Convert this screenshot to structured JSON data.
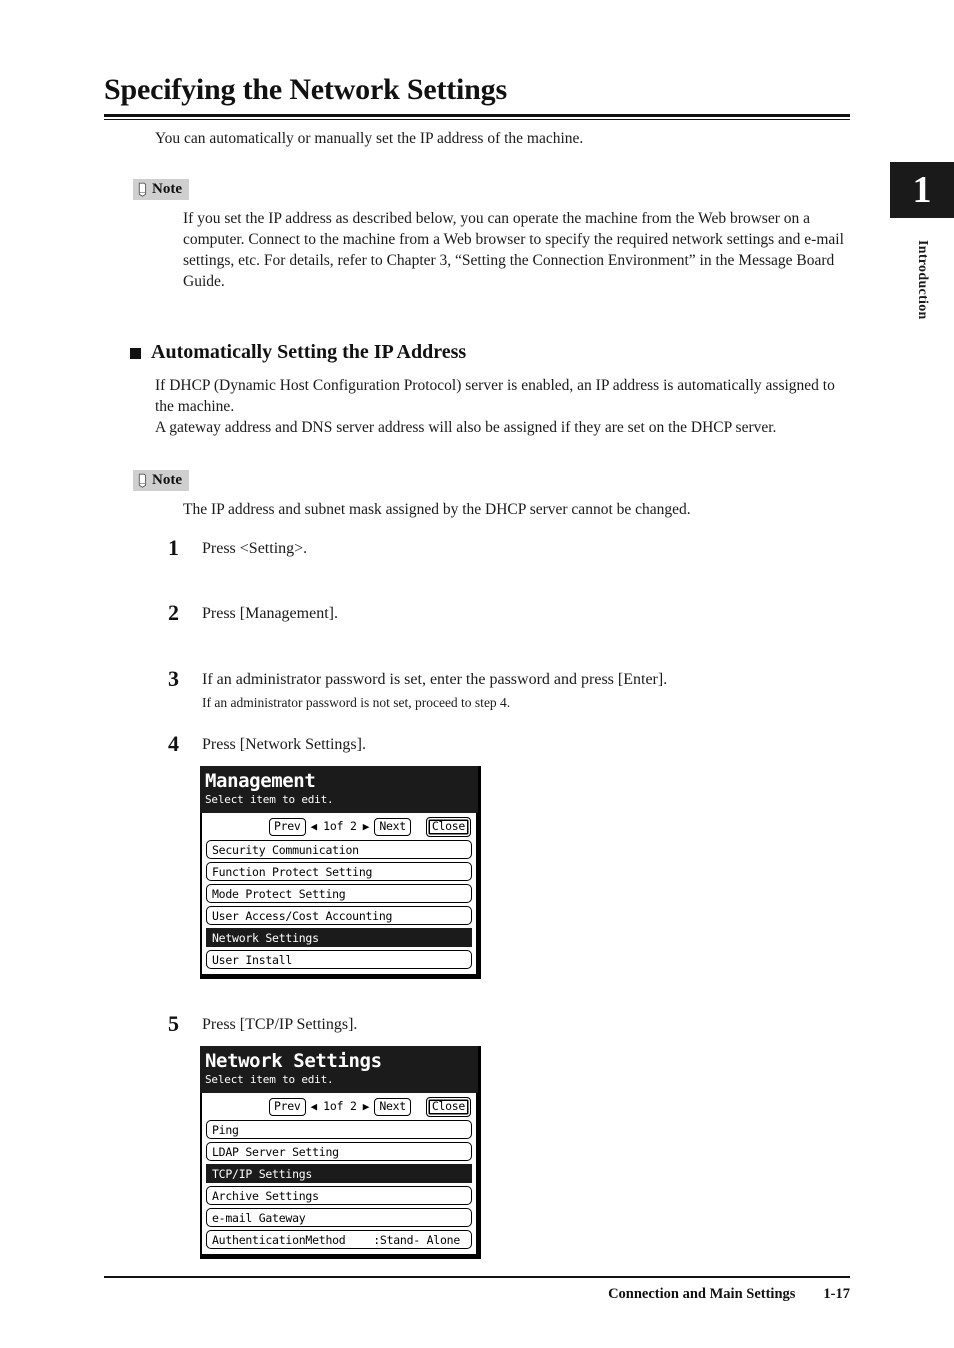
{
  "document": {
    "title": "Specifying the Network Settings",
    "intro": "You can automatically or manually set the IP address of the machine."
  },
  "chapter_tab": {
    "number": "1",
    "label": "Introduction"
  },
  "note_1": {
    "badge": "Note",
    "icon": "note-pencil-icon",
    "text": "If you set the IP address as described below, you can operate the machine from the Web browser on a computer. Connect to the machine from a Web browser to specify the required network settings and e-mail settings, etc. For details, refer to Chapter 3, “Setting the Connection Environment” in the Message Board Guide."
  },
  "section": {
    "marker": "square-bullet-icon",
    "heading": "Automatically Setting the IP Address",
    "paragraph_1": "If DHCP (Dynamic Host Configuration Protocol) server is enabled, an IP address is automatically assigned to the machine.",
    "paragraph_2": "A gateway address and DNS server address will also be assigned if they are set on the DHCP server."
  },
  "note_2": {
    "badge": "Note",
    "icon": "note-pencil-icon",
    "text": "The IP address and subnet mask assigned by the DHCP server cannot be changed."
  },
  "steps": [
    {
      "num": "1",
      "text": "Press <Setting>.",
      "sub": ""
    },
    {
      "num": "2",
      "text": "Press [Management].",
      "sub": ""
    },
    {
      "num": "3",
      "text": "If an administrator password is set, enter the password and press [Enter].",
      "sub": "If an administrator password is not set, proceed to step 4."
    },
    {
      "num": "4",
      "text": "Press [Network Settings].",
      "sub": ""
    },
    {
      "num": "5",
      "text": "Press [TCP/IP Settings].",
      "sub": ""
    }
  ],
  "lcd_management": {
    "title": "Management",
    "subtitle": "Select item to edit.",
    "nav": {
      "prev": "Prev",
      "prev_arrow": "◀",
      "page": "1of  2",
      "next_arrow": "▶",
      "next": "Next",
      "close": "Close"
    },
    "rows": [
      {
        "label": "Security Communication",
        "value": "",
        "selected": false
      },
      {
        "label": "Function Protect Setting",
        "value": "",
        "selected": false
      },
      {
        "label": "Mode Protect Setting",
        "value": "",
        "selected": false
      },
      {
        "label": "User Access/Cost Accounting",
        "value": "",
        "selected": false
      },
      {
        "label": "Network Settings",
        "value": "",
        "selected": true
      },
      {
        "label": "User Install",
        "value": "",
        "selected": false
      }
    ]
  },
  "lcd_network": {
    "title": "Network Settings",
    "subtitle": "Select item to edit.",
    "nav": {
      "prev": "Prev",
      "prev_arrow": "◀",
      "page": "1of  2",
      "next_arrow": "▶",
      "next": "Next",
      "close": "Close"
    },
    "rows": [
      {
        "label": "Ping",
        "value": "",
        "selected": false
      },
      {
        "label": "LDAP Server Setting",
        "value": "",
        "selected": false
      },
      {
        "label": "TCP/IP Settings",
        "value": "",
        "selected": true
      },
      {
        "label": "Archive Settings",
        "value": "",
        "selected": false
      },
      {
        "label": "e-mail Gateway",
        "value": "",
        "selected": false
      },
      {
        "label": "AuthenticationMethod",
        "value": ":Stand- Alone",
        "selected": false
      }
    ]
  },
  "footer": {
    "chapter": "Connection and Main Settings",
    "page": "1-17"
  }
}
